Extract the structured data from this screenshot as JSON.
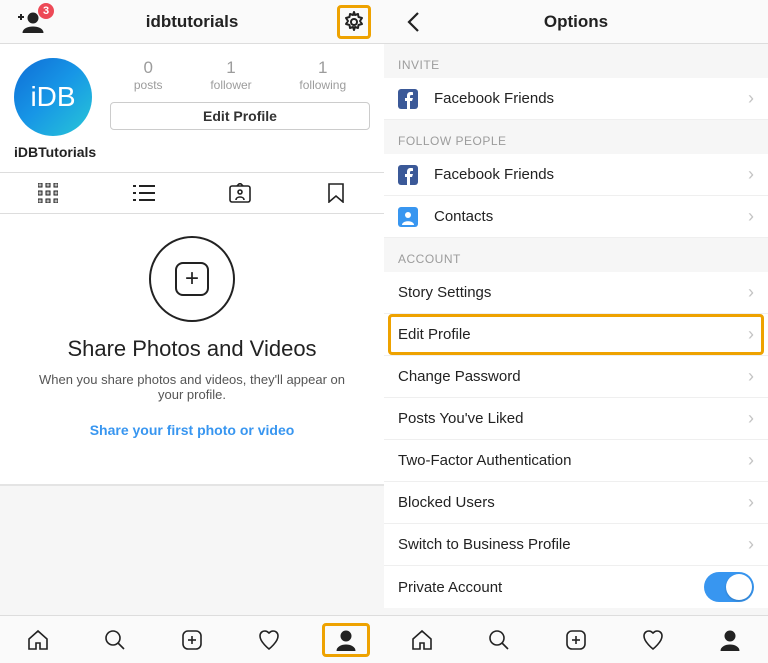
{
  "left": {
    "header": {
      "username": "idbtutorials",
      "friend_request_badge": "3"
    },
    "profile": {
      "avatar_text": "iDB",
      "display_name": "iDBTutorials",
      "stats": {
        "posts": {
          "value": "0",
          "label": "posts"
        },
        "followers": {
          "value": "1",
          "label": "follower"
        },
        "following": {
          "value": "1",
          "label": "following"
        }
      },
      "edit_button": "Edit Profile"
    },
    "empty_state": {
      "title": "Share Photos and Videos",
      "subtitle": "When you share photos and videos, they'll appear on your profile.",
      "cta": "Share your first photo or video"
    }
  },
  "right": {
    "header": {
      "title": "Options"
    },
    "groups": {
      "invite": {
        "header": "Invite",
        "items": [
          {
            "label": "Facebook Friends",
            "icon": "facebook"
          }
        ]
      },
      "follow_people": {
        "header": "Follow People",
        "items": [
          {
            "label": "Facebook Friends",
            "icon": "facebook"
          },
          {
            "label": "Contacts",
            "icon": "contacts"
          }
        ]
      },
      "account": {
        "header": "Account",
        "items": [
          {
            "label": "Story Settings"
          },
          {
            "label": "Edit Profile"
          },
          {
            "label": "Change Password"
          },
          {
            "label": "Posts You've Liked"
          },
          {
            "label": "Two-Factor Authentication"
          },
          {
            "label": "Blocked Users"
          },
          {
            "label": "Switch to Business Profile"
          },
          {
            "label": "Private Account"
          }
        ]
      }
    }
  }
}
